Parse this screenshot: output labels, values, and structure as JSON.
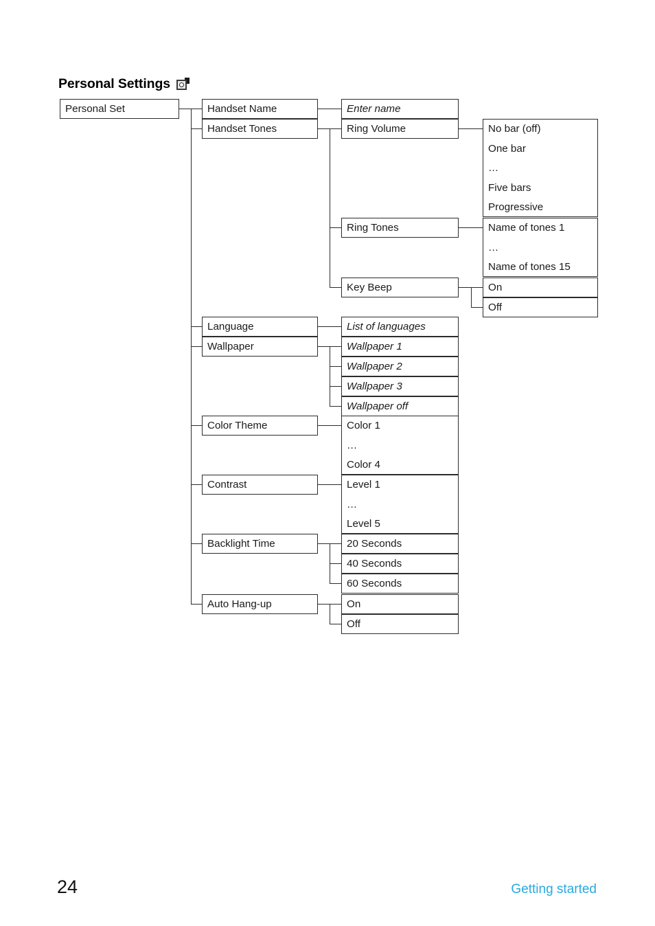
{
  "heading": {
    "title": "Personal Settings",
    "icon": "personal-settings-menu-icon"
  },
  "footer": {
    "page_number": "24",
    "section": "Getting started"
  },
  "colors": {
    "accent_blue": "#29a9e0",
    "line": "#2b2b2b",
    "text": "#1a1a1a"
  },
  "tree": {
    "root": "Personal Set",
    "level1": [
      {
        "label": "Handset Name"
      },
      {
        "label": "Handset Tones"
      },
      {
        "label": "Language"
      },
      {
        "label": "Wallpaper"
      },
      {
        "label": "Color Theme"
      },
      {
        "label": "Contrast"
      },
      {
        "label": "Backlight Time"
      },
      {
        "label": "Auto Hang-up"
      }
    ],
    "handset_name_value": "Enter name",
    "handset_tones": [
      {
        "label": "Ring Volume"
      },
      {
        "label": "Ring Tones"
      },
      {
        "label": "Key Beep"
      }
    ],
    "ring_volume_options": [
      "No bar (off)",
      "One bar",
      "…",
      "Five bars",
      "Progressive"
    ],
    "ring_tones_options": [
      "Name of tones 1",
      "…",
      "Name of tones 15"
    ],
    "key_beep_options": [
      "On",
      "Off"
    ],
    "language_value": "List of languages",
    "wallpaper_options": [
      "Wallpaper 1",
      "Wallpaper 2",
      "Wallpaper 3",
      "Wallpaper off"
    ],
    "color_theme_options": [
      "Color 1",
      "…",
      "Color 4"
    ],
    "contrast_options": [
      "Level 1",
      "…",
      "Level 5"
    ],
    "backlight_time_options": [
      "20 Seconds",
      "40 Seconds",
      "60 Seconds"
    ],
    "auto_hangup_options": [
      "On",
      "Off"
    ]
  }
}
